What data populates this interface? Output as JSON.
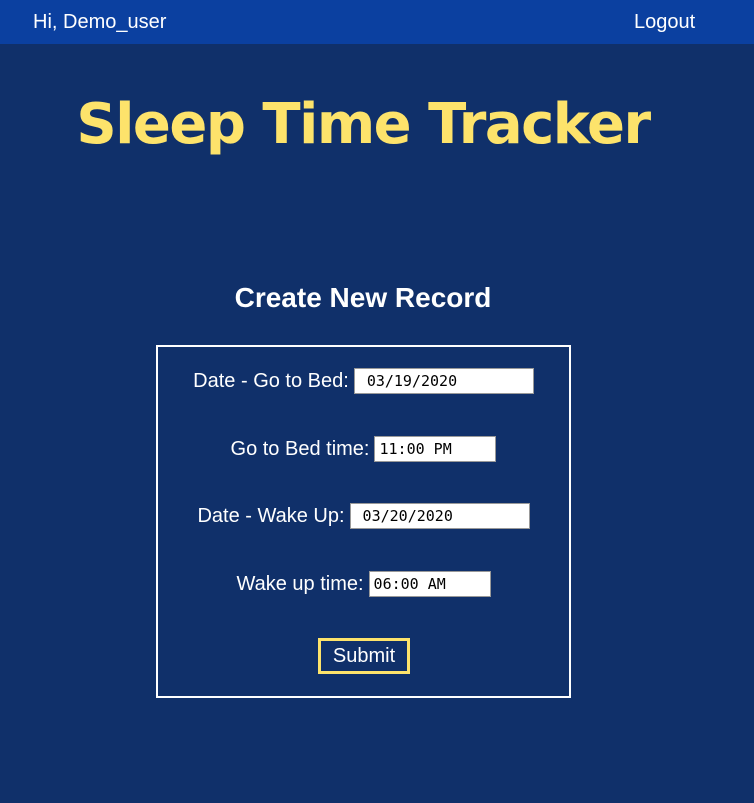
{
  "header": {
    "greeting": "Hi, Demo_user",
    "logout_label": "Logout"
  },
  "app": {
    "title": "Sleep Time Tracker"
  },
  "form": {
    "heading": "Create New Record",
    "fields": [
      {
        "label": "Date - Go to Bed:",
        "value": "03/19/2020",
        "type": "date"
      },
      {
        "label": "Go to Bed time:",
        "value": "11:00 PM",
        "type": "time"
      },
      {
        "label": "Date - Wake Up:",
        "value": "03/20/2020",
        "type": "date"
      },
      {
        "label": "Wake up time:",
        "value": "06:00 AM",
        "type": "time"
      }
    ],
    "submit_label": "Submit"
  },
  "colors": {
    "background": "#10306a",
    "topbar": "#0b40a0",
    "accent": "#fde36b",
    "text": "#ffffff"
  }
}
